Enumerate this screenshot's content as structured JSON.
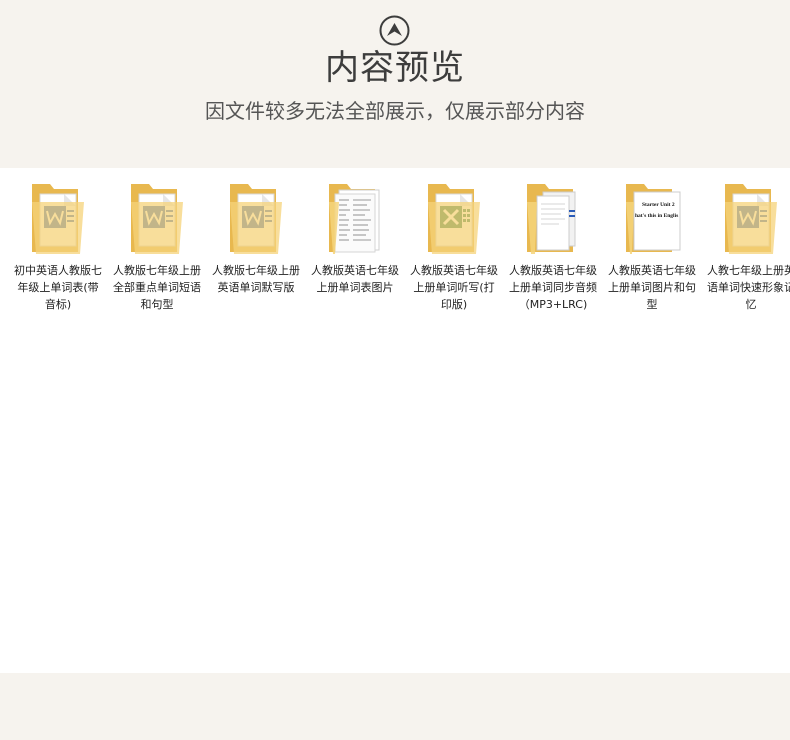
{
  "header": {
    "title": "内容预览",
    "subtitle": "因文件较多无法全部展示，仅展示部分内容"
  },
  "files": [
    {
      "name": "初中英语人教版七年级上单词表(带音标)",
      "type": "word"
    },
    {
      "name": "人教版七年级上册全部重点单词短语和句型",
      "type": "word"
    },
    {
      "name": "人教版七年级上册英语单词默写版",
      "type": "word"
    },
    {
      "name": "人教版英语七年级上册单词表图片",
      "type": "image-list"
    },
    {
      "name": "人教版英语七年级上册单词听写(打印版)",
      "type": "excel"
    },
    {
      "name": "人教版英语七年级上册单词同步音频（MP3+LRC)",
      "type": "audio-doc"
    },
    {
      "name": "人教版英语七年级上册单词图片和句型",
      "type": "image-doc",
      "preview_text": [
        "Starter Unit 2",
        "hat's this in Englis"
      ]
    },
    {
      "name": "人教七年级上册英语单词快速形象记忆",
      "type": "word"
    }
  ],
  "colors": {
    "background": "#f6f3ee",
    "content": "#ffffff",
    "folder": "#f5d37a",
    "word_blue": "#2b5cb8",
    "excel_green": "#1e7145"
  }
}
